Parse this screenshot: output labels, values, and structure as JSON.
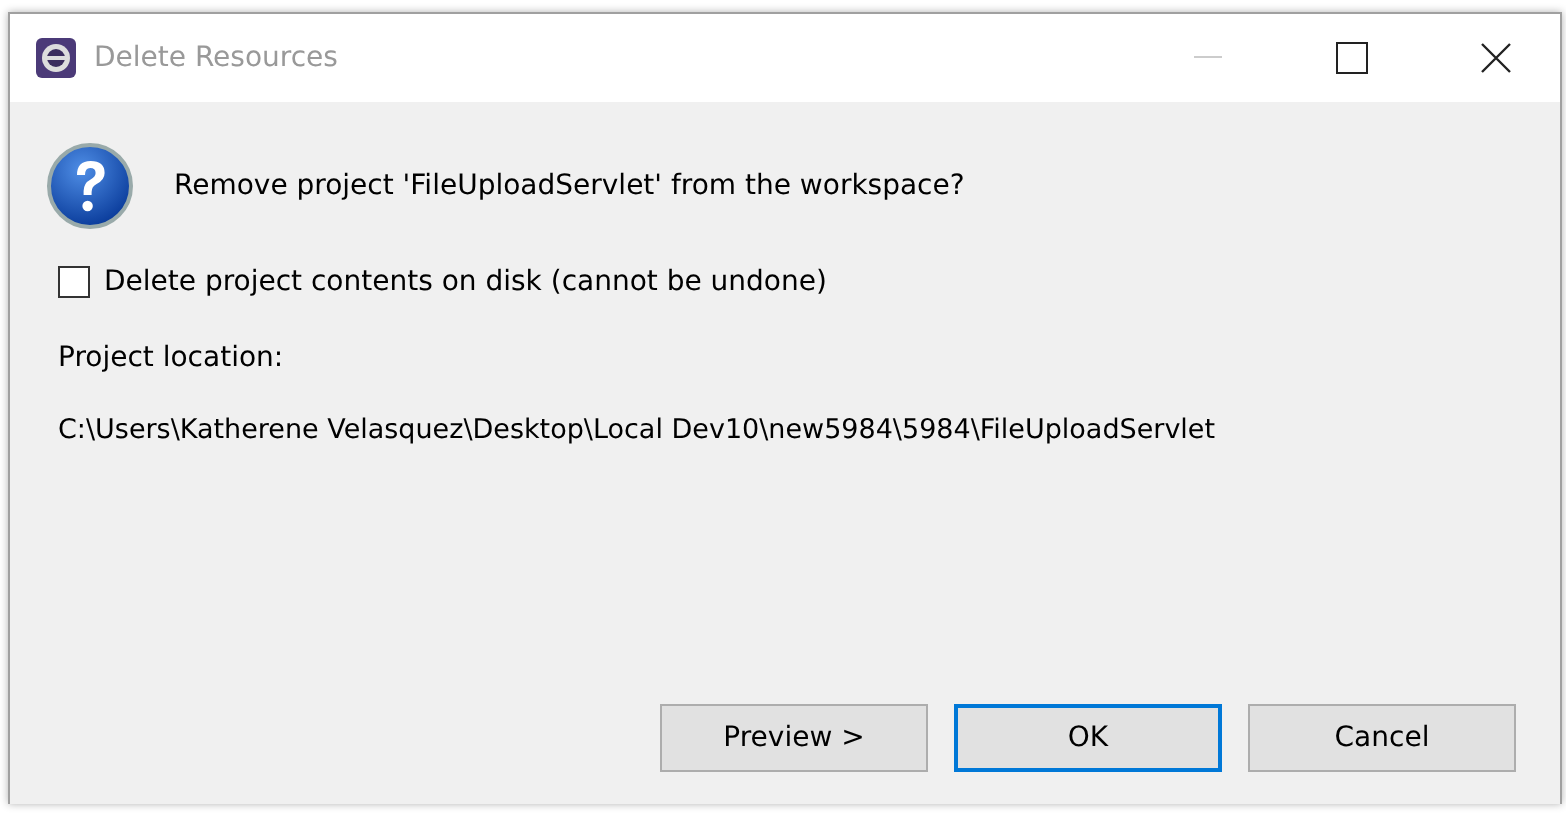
{
  "window": {
    "title": "Delete Resources",
    "active": false,
    "minimize_disabled": true
  },
  "message": "Remove project 'FileUploadServlet' from the workspace?",
  "checkbox": {
    "label": "Delete project contents on disk (cannot be undone)",
    "checked": false
  },
  "location_label": "Project location:",
  "location_path": "C:\\Users\\Katherene Velasquez\\Desktop\\Local Dev10\\new5984\\5984\\FileUploadServlet",
  "buttons": [
    {
      "label": "Preview >",
      "default": false
    },
    {
      "label": "OK",
      "default": true
    },
    {
      "label": "Cancel",
      "default": false
    }
  ]
}
